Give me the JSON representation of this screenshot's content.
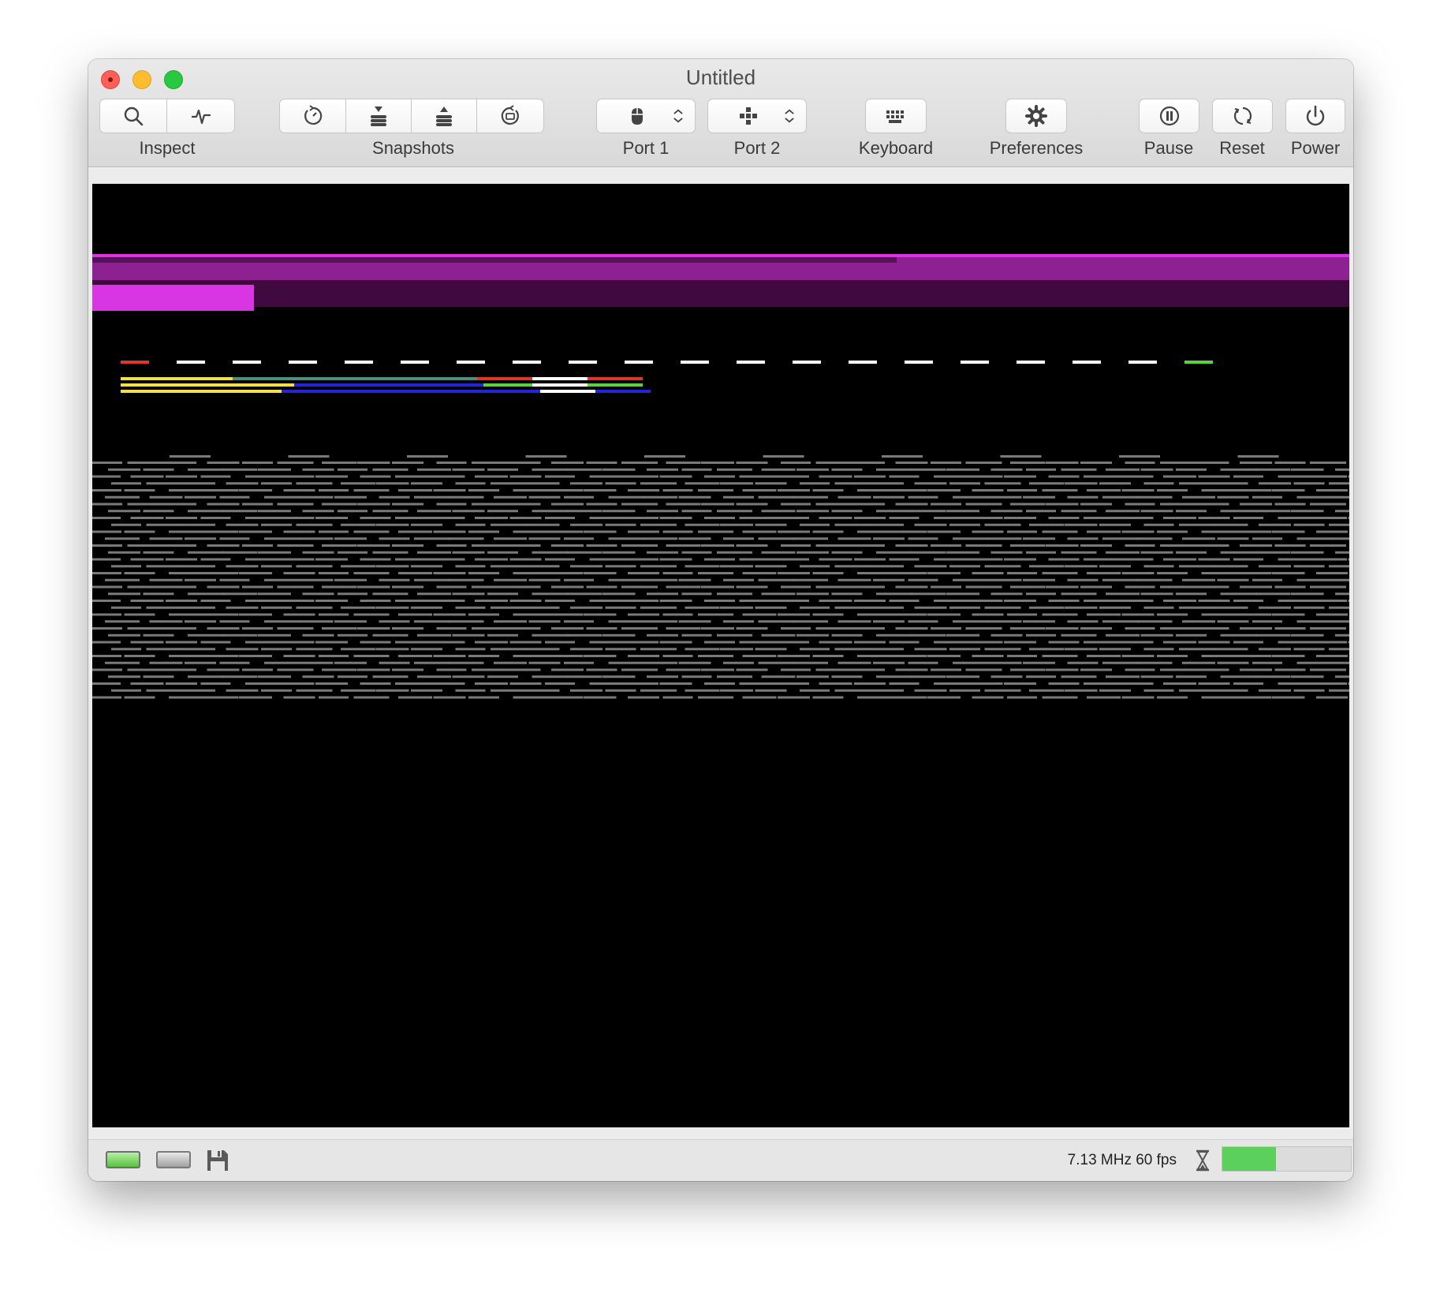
{
  "window": {
    "title": "Untitled"
  },
  "toolbar": {
    "inspect_label": "Inspect",
    "snapshots_label": "Snapshots",
    "port1_label": "Port 1",
    "port2_label": "Port 2",
    "keyboard_label": "Keyboard",
    "preferences_label": "Preferences",
    "pause_label": "Pause",
    "reset_label": "Reset",
    "power_label": "Power",
    "icons": [
      "magnifier-icon",
      "activity-icon",
      "snapshot-history-icon",
      "stack-down-icon",
      "stack-up-icon",
      "restore-icon",
      "mouse-icon",
      "joystick-icon",
      "keyboard-icon",
      "gear-icon",
      "pause-icon",
      "reset-icon",
      "power-icon"
    ]
  },
  "status": {
    "speed_text": "7.13 MHz 60 fps",
    "load_fraction": 0.42,
    "icons": [
      "drive-active-icon",
      "drive-idle-icon",
      "floppy-disk-icon",
      "hourglass-icon"
    ],
    "load_color": "#5bd15c"
  },
  "screen": {
    "background": "#000000",
    "colors": {
      "magenta_bright": "#d936e3",
      "magenta_mid": "#8d2192",
      "magenta_dark": "#3e0a3f",
      "red": "#e03527",
      "white": "#ffffff",
      "green": "#5bd13e",
      "yellow": "#f2e04a",
      "teal": "#4d8f7c",
      "blue": "#2424d9",
      "gray": "#7a7a7a"
    }
  }
}
